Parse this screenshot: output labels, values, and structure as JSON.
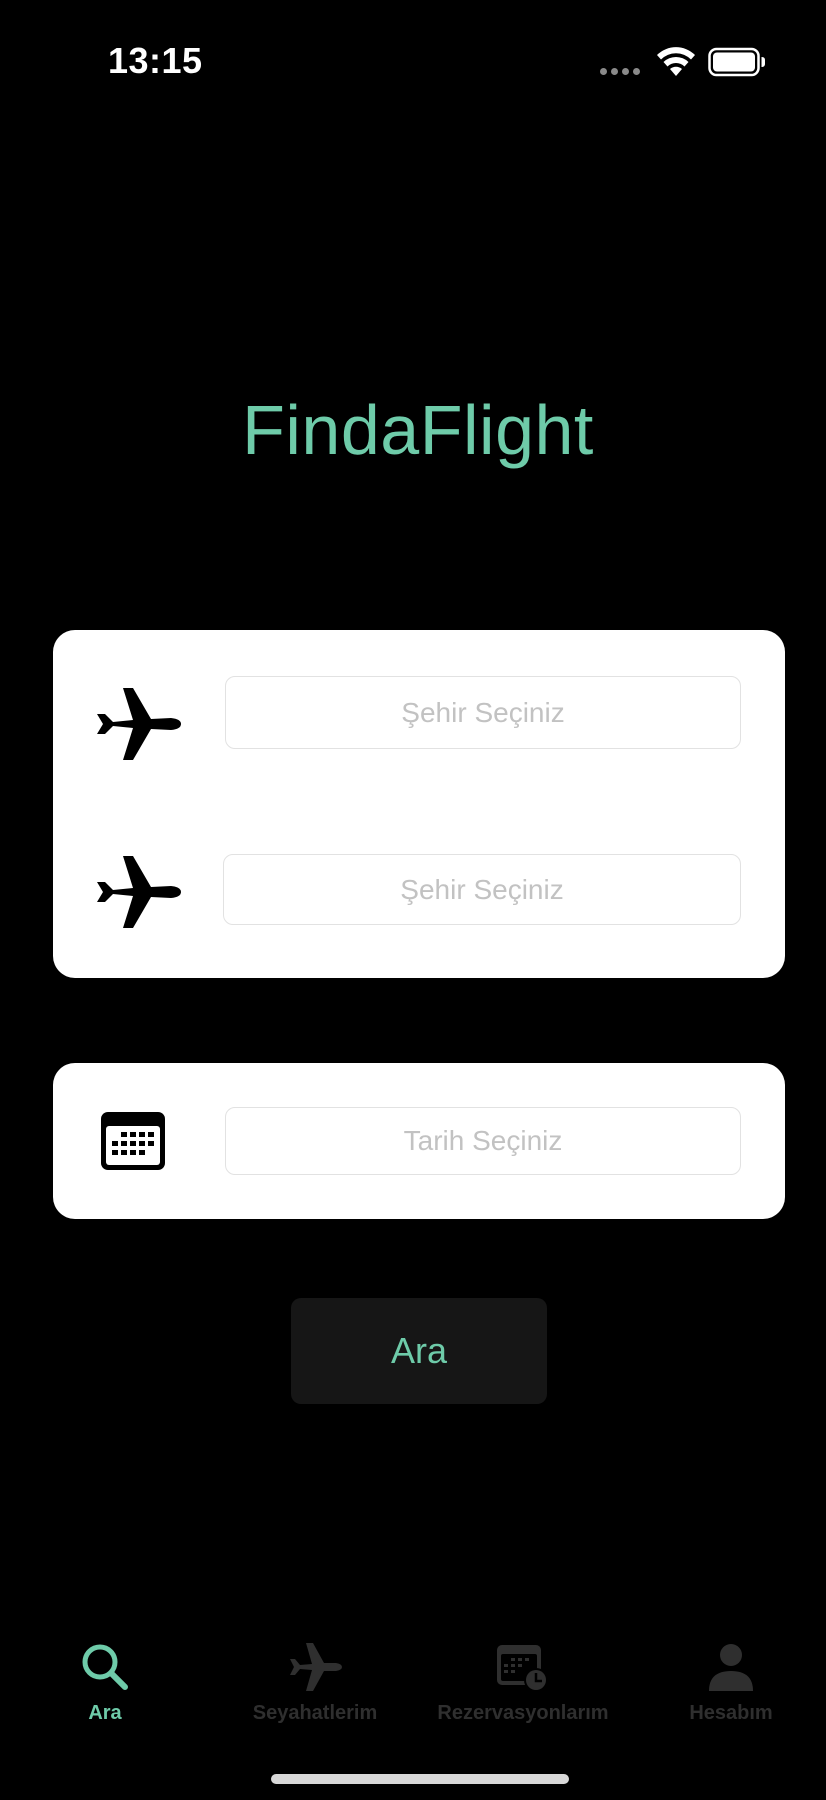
{
  "status_bar": {
    "time": "13:15"
  },
  "app": {
    "title": "FindaFlight",
    "accent_color": "#6ecba9"
  },
  "form": {
    "from_placeholder": "Şehir Seçiniz",
    "to_placeholder": "Şehir Seçiniz",
    "date_placeholder": "Tarih Seçiniz",
    "search_label": "Ara",
    "icons": [
      "airplane-icon",
      "airplane-icon",
      "calendar-icon"
    ]
  },
  "tab_bar": {
    "active": "Ara",
    "items": [
      {
        "label": "Ara",
        "icon": "search-icon"
      },
      {
        "label": "Seyahatlerim",
        "icon": "airplane-icon"
      },
      {
        "label": "Rezervasyonlarım",
        "icon": "calendar-clock-icon"
      },
      {
        "label": "Hesabım",
        "icon": "person-icon"
      }
    ]
  }
}
